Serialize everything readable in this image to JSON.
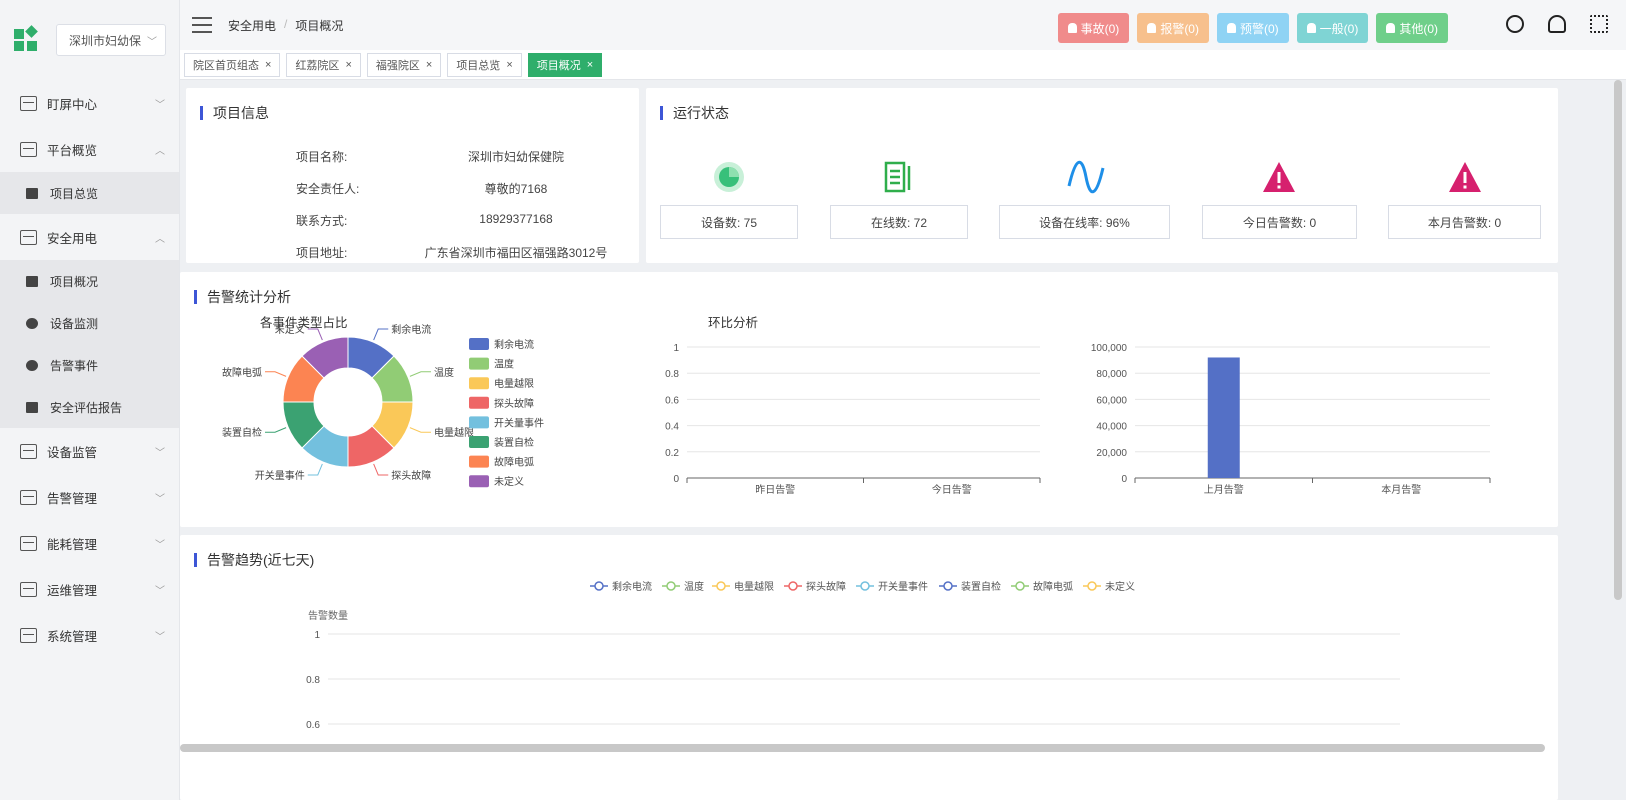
{
  "sidebar": {
    "org": "深圳市妇幼保",
    "menu": [
      {
        "label": "盯屏中心"
      },
      {
        "label": "平台概览"
      },
      {
        "label": "安全用电"
      },
      {
        "label": "设备监管"
      },
      {
        "label": "告警管理"
      },
      {
        "label": "能耗管理"
      },
      {
        "label": "运维管理"
      },
      {
        "label": "系统管理"
      }
    ],
    "platform_sub": [
      "项目总览"
    ],
    "safety_sub": [
      "项目概况",
      "设备监测",
      "告警事件",
      "安全评估报告"
    ]
  },
  "header": {
    "breadcrumb": [
      "安全用电",
      "项目概况"
    ],
    "alarms": [
      {
        "label": "事故(0)",
        "color": "#f08b8b"
      },
      {
        "label": "报警(0)",
        "color": "#f7c08d"
      },
      {
        "label": "预警(0)",
        "color": "#8fd3f4"
      },
      {
        "label": "一般(0)",
        "color": "#7fd4d4"
      },
      {
        "label": "其他(0)",
        "color": "#6fcf8a"
      }
    ]
  },
  "tabs": [
    {
      "label": "院区首页组态"
    },
    {
      "label": "红荔院区"
    },
    {
      "label": "福强院区"
    },
    {
      "label": "项目总览"
    },
    {
      "label": "项目概况"
    }
  ],
  "project_info": {
    "title": "项目信息",
    "rows": [
      {
        "k": "项目名称:",
        "v": "深圳市妇幼保健院"
      },
      {
        "k": "安全责任人:",
        "v": "尊敬的7168"
      },
      {
        "k": "联系方式:",
        "v": "18929377168"
      },
      {
        "k": "项目地址:",
        "v": "广东省深圳市福田区福强路3012号"
      }
    ]
  },
  "run_status": {
    "title": "运行状态",
    "stats": [
      {
        "label": "设备数: 75",
        "icon": "pie-icon"
      },
      {
        "label": "在线数: 72",
        "icon": "list-icon"
      },
      {
        "label": "设备在线率: 96%",
        "icon": "wave-icon"
      },
      {
        "label": "今日告警数: 0",
        "icon": "warning-icon"
      },
      {
        "label": "本月告警数: 0",
        "icon": "warning-icon"
      }
    ]
  },
  "alarm_analysis": {
    "title": "告警统计分析",
    "pie_title": "各事件类型占比",
    "ratio_title": "环比分析"
  },
  "trend": {
    "title": "告警趋势(近七天)",
    "ylabel": "告警数量"
  },
  "chart_data": [
    {
      "type": "pie",
      "title": "各事件类型占比",
      "categories": [
        "剩余电流",
        "温度",
        "电量越限",
        "探头故障",
        "开关量事件",
        "装置自检",
        "故障电弧",
        "未定义"
      ],
      "values": [
        1,
        1,
        1,
        1,
        1,
        1,
        1,
        1
      ],
      "colors": [
        "#5470c6",
        "#91cc75",
        "#fac858",
        "#ee6666",
        "#73c0de",
        "#3ba272",
        "#fc8452",
        "#9a60b4"
      ]
    },
    {
      "type": "bar",
      "title": "环比分析",
      "categories": [
        "昨日告警",
        "今日告警"
      ],
      "values": [
        0,
        0
      ],
      "ylim": [
        0,
        1
      ],
      "yticks": [
        "0",
        "0.2",
        "0.4",
        "0.6",
        "0.8",
        "1"
      ]
    },
    {
      "type": "bar",
      "categories": [
        "上月告警",
        "本月告警"
      ],
      "values": [
        92000,
        0
      ],
      "ylim": [
        0,
        100000
      ],
      "yticks": [
        "0",
        "20,000",
        "40,000",
        "60,000",
        "80,000",
        "100,000"
      ],
      "color": "#5470c6"
    },
    {
      "type": "line",
      "title": "告警趋势(近七天)",
      "ylabel": "告警数量",
      "series": [
        {
          "name": "剩余电流",
          "color": "#5470c6"
        },
        {
          "name": "温度",
          "color": "#91cc75"
        },
        {
          "name": "电量越限",
          "color": "#fac858"
        },
        {
          "name": "探头故障",
          "color": "#ee6666"
        },
        {
          "name": "开关量事件",
          "color": "#73c0de"
        },
        {
          "name": "装置自检",
          "color": "#5470c6"
        },
        {
          "name": "故障电弧",
          "color": "#91cc75"
        },
        {
          "name": "未定义",
          "color": "#fac858"
        }
      ],
      "yticks": [
        "1",
        "0.8",
        "0.6"
      ]
    }
  ]
}
